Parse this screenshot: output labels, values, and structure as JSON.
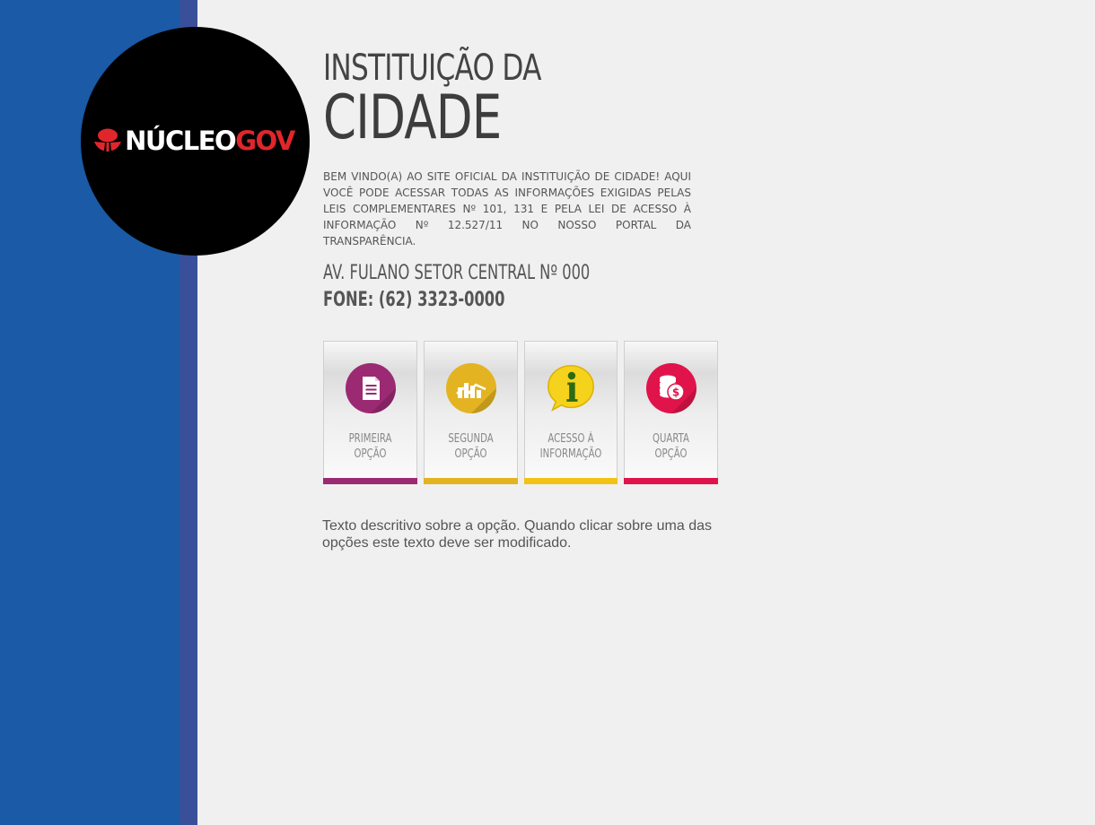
{
  "brand": {
    "logo_part1": "NÚCLEO",
    "logo_part2": "GOV",
    "colors": {
      "sidebar": "#1a5aa6",
      "stripe": "#3a4f9a",
      "logo_red": "#e1262b"
    }
  },
  "header": {
    "title_line1": "INSTITUIÇÃO DA",
    "title_line2": "CIDADE"
  },
  "intro": {
    "text": "BEM VINDO(A) AO SITE OFICIAL DA INSTITUIÇÃO DE CIDADE! AQUI VOCÊ PODE ACESSAR TODAS AS INFORMAÇÕES EXIGIDAS PELAS LEIS COMPLEMENTARES Nº 101, 131 E PELA LEI DE ACESSO À INFORMAÇÃO Nº 12.527/11 NO NOSSO PORTAL DA TRANSPARÊNCIA."
  },
  "contact": {
    "address": "AV. FULANO SETOR CENTRAL Nº 000",
    "phone": "FONE: (62) 3323-0000"
  },
  "options": [
    {
      "line1": "PRIMEIRA",
      "line2": "OPÇÃO",
      "icon": "document-icon",
      "color": "#9b2a72"
    },
    {
      "line1": "SEGUNDA",
      "line2": "OPÇÃO",
      "icon": "chart-icon",
      "color": "#e3b321"
    },
    {
      "line1": "ACESSO À",
      "line2": "INFORMAÇÃO",
      "icon": "info-icon",
      "color": "#f2c316"
    },
    {
      "line1": "QUARTA",
      "line2": "OPÇÃO",
      "icon": "coins-icon",
      "color": "#e0144a"
    }
  ],
  "description": {
    "text": "Texto descritivo sobre a opção. Quando clicar sobre uma das opções este texto deve ser modificado."
  }
}
